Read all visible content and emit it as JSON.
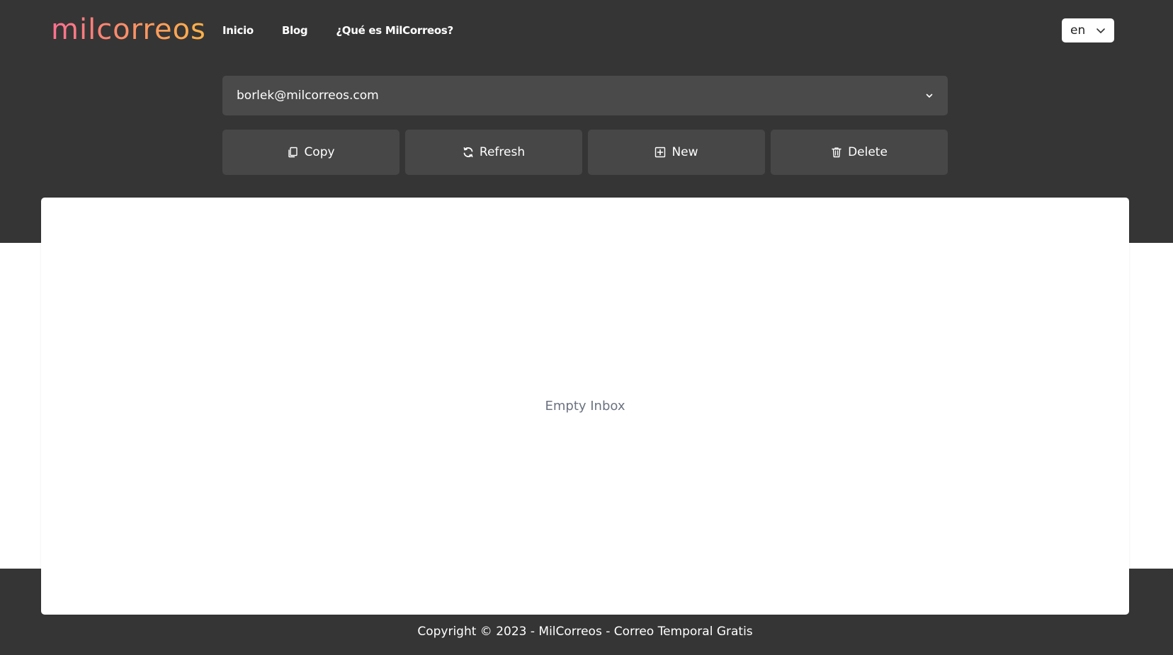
{
  "header": {
    "logo_text": "milcorreos",
    "nav": [
      {
        "label": "Inicio"
      },
      {
        "label": "Blog"
      },
      {
        "label": "¿Qué es MilCorreos?"
      }
    ],
    "language": {
      "selected": "en"
    }
  },
  "mailbox": {
    "address": "borlek@milcorreos.com",
    "actions": {
      "copy": "Copy",
      "refresh": "Refresh",
      "new": "New",
      "delete": "Delete"
    }
  },
  "inbox": {
    "empty_message": "Empty Inbox"
  },
  "footer": {
    "copyright": "Copyright © 2023 - MilCorreos - Correo Temporal Gratis"
  },
  "colors": {
    "background_dark": "#353535",
    "panel": "#ffffff",
    "button": "#474747",
    "input": "#4a4a4a",
    "logo_gradient_start": "#ff6f91",
    "logo_gradient_end": "#ffb347"
  },
  "icons": {
    "copy": "copy-icon",
    "refresh": "refresh-icon",
    "new": "plus-square-icon",
    "delete": "trash-icon",
    "dropdown": "chevron-down-icon"
  }
}
